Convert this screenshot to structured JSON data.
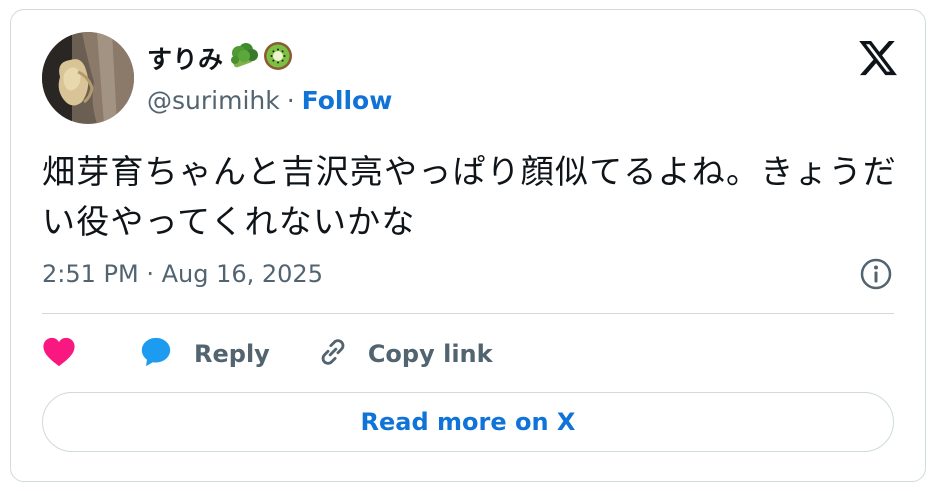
{
  "author": {
    "display_name": "すりみ",
    "emoji_icons": [
      "broccoli-icon",
      "kiwi-icon"
    ],
    "handle": "@surimihk",
    "separator": "·",
    "follow_label": "Follow"
  },
  "tweet": {
    "text": "畑芽育ちゃんと吉沢亮やっぱり顔似てるよね。きょうだい役やってくれないかな",
    "timestamp": "2:51 PM · Aug 16, 2025"
  },
  "actions": {
    "like_icon": "heart-icon",
    "reply_label": "Reply",
    "copy_link_label": "Copy link"
  },
  "footer": {
    "read_more_label": "Read more on X"
  },
  "colors": {
    "link_blue": "#0f73d8",
    "like_pink": "#f91880",
    "reply_blue": "#1d9bf0",
    "muted_text": "#536471",
    "border": "#cfd9de"
  }
}
